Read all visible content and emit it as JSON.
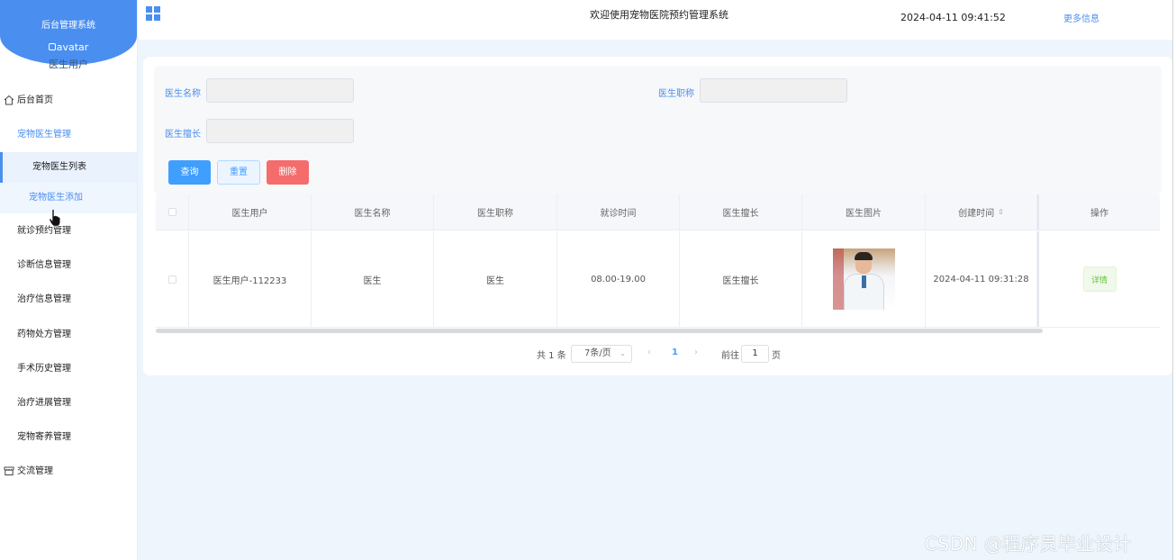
{
  "sidebar": {
    "system_title": "后台管理系统",
    "avatar_alt": "avatar",
    "user_name": "医生用户",
    "items": [
      {
        "label": "后台首页",
        "icon": "home-icon"
      },
      {
        "label": "宠物医生管理",
        "active": true
      },
      {
        "label": "宠物医生列表",
        "sub": true,
        "selected": true
      },
      {
        "label": "宠物医生添加",
        "sub": true,
        "hover": true
      },
      {
        "label": "就诊预约管理"
      },
      {
        "label": "诊断信息管理"
      },
      {
        "label": "治疗信息管理"
      },
      {
        "label": "药物处方管理"
      },
      {
        "label": "手术历史管理"
      },
      {
        "label": "治疗进展管理"
      },
      {
        "label": "宠物寄养管理"
      },
      {
        "label": "交流管理",
        "icon": "shop-icon"
      }
    ]
  },
  "header": {
    "title": "欢迎使用宠物医院预约管理系统",
    "datetime": "2024-04-11 09:41:52",
    "more": "更多信息"
  },
  "search": {
    "name_label": "医生名称",
    "name_value": "",
    "title_label": "医生职称",
    "title_value": "",
    "specialty_label": "医生擅长",
    "specialty_value": "",
    "query_button": "查询",
    "reset_button": "重置",
    "delete_button": "删除"
  },
  "table": {
    "columns": [
      "医生用户",
      "医生名称",
      "医生职称",
      "就诊时间",
      "医生擅长",
      "医生图片",
      "创建时间",
      "操作"
    ],
    "rows": [
      {
        "user": "医生用户-112233",
        "name": "医生",
        "title": "医生",
        "hours": "08.00-19.00",
        "specialty": "医生擅长",
        "created": "2024-04-11 09:31:28",
        "action": "详情"
      }
    ]
  },
  "pagination": {
    "total": "共 1 条",
    "page_size": "7条/页",
    "current": "1",
    "goto_label": "前往",
    "goto_value": "1",
    "page_suffix": "页"
  },
  "watermark": "CSDN @程序员毕业设计",
  "colors": {
    "primary": "#409eff",
    "sidebar_header": "#4a8ff0",
    "danger": "#f56c6c",
    "success": "#67c23a"
  }
}
